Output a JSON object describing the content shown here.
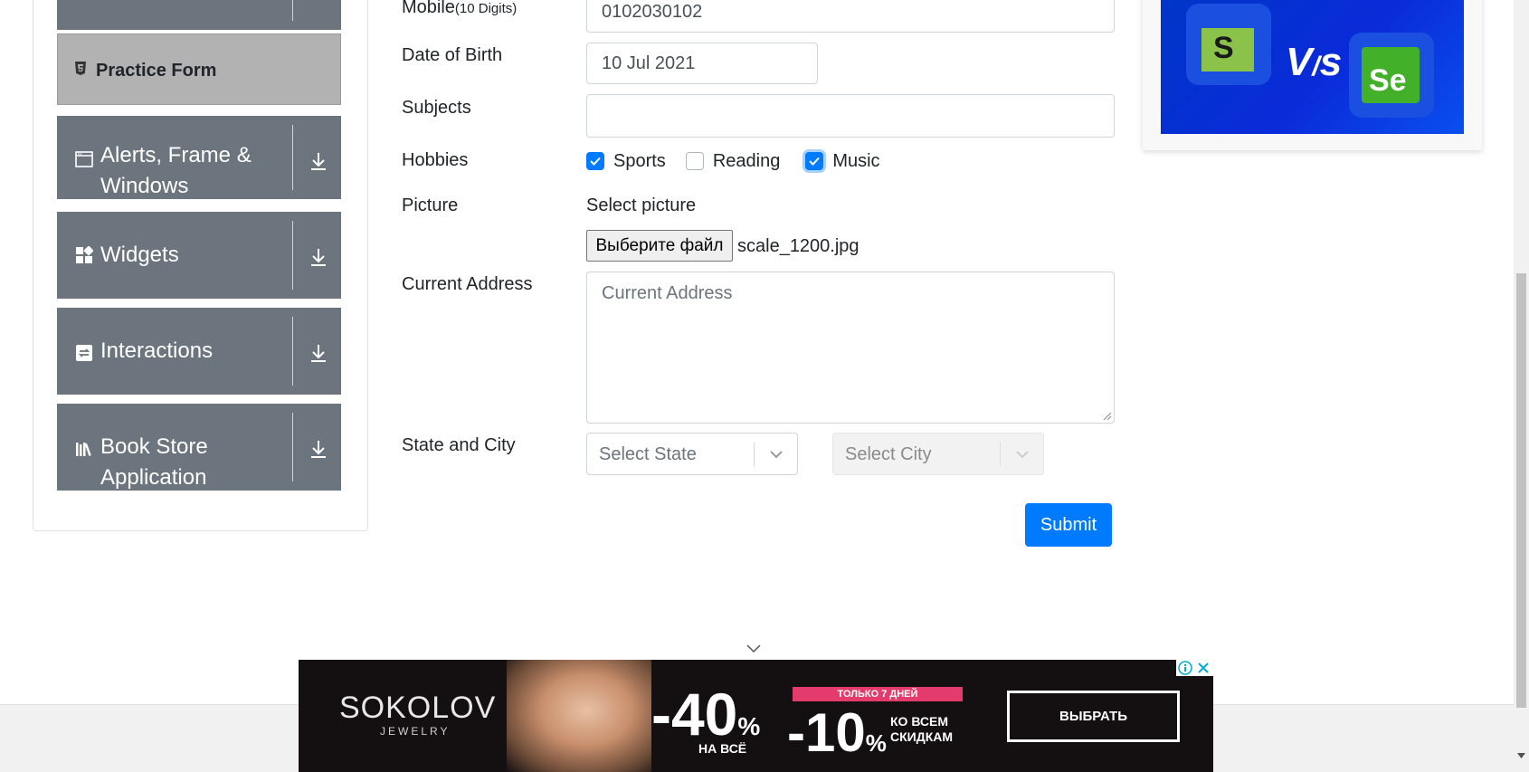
{
  "sidebar": {
    "active_item": "Practice Form",
    "groups": [
      {
        "label_line1": "Alerts, Frame &",
        "label_line2": "Windows",
        "icon": "window-icon"
      },
      {
        "label_line1": "Widgets",
        "label_line2": "",
        "icon": "widgets-icon"
      },
      {
        "label_line1": "Interactions",
        "label_line2": "",
        "icon": "interactions-icon"
      },
      {
        "label_line1": "Book Store",
        "label_line2": "Application",
        "icon": "books-icon"
      }
    ]
  },
  "form": {
    "mobile_label": "Mobile",
    "mobile_hint": "(10 Digits)",
    "mobile_value": "0102030102",
    "dob_label": "Date of Birth",
    "dob_value": "10 Jul 2021",
    "subjects_label": "Subjects",
    "subjects_value": "",
    "hobbies_label": "Hobbies",
    "hobbies": [
      {
        "label": "Sports",
        "checked": true
      },
      {
        "label": "Reading",
        "checked": false
      },
      {
        "label": "Music",
        "checked": true
      }
    ],
    "picture_label": "Picture",
    "picture_prompt": "Select picture",
    "file_button": "Выберите файл",
    "file_name": "scale_1200.jpg",
    "address_label": "Current Address",
    "address_placeholder": "Current Address",
    "state_city_label": "State and City",
    "state_placeholder": "Select State",
    "city_placeholder": "Select City",
    "submit": "Submit"
  },
  "ad": {
    "brand": "SOKOLOV",
    "brand_sub": "JEWELRY",
    "discount1": "-40",
    "discount1_pct": "%",
    "discount1_sub": "НА ВСЁ",
    "badge": "ТОЛЬКО 7 ДНЕЙ",
    "discount2": "-10",
    "discount2_pct": "%",
    "discount2_sub1": "КО ВСЕМ",
    "discount2_sub2": "СКИДКАМ",
    "button": "ВЫБРАТЬ"
  },
  "colors": {
    "primary": "#007bff",
    "sidebar_group": "#6c757d",
    "active_item": "#b2b2b2"
  }
}
